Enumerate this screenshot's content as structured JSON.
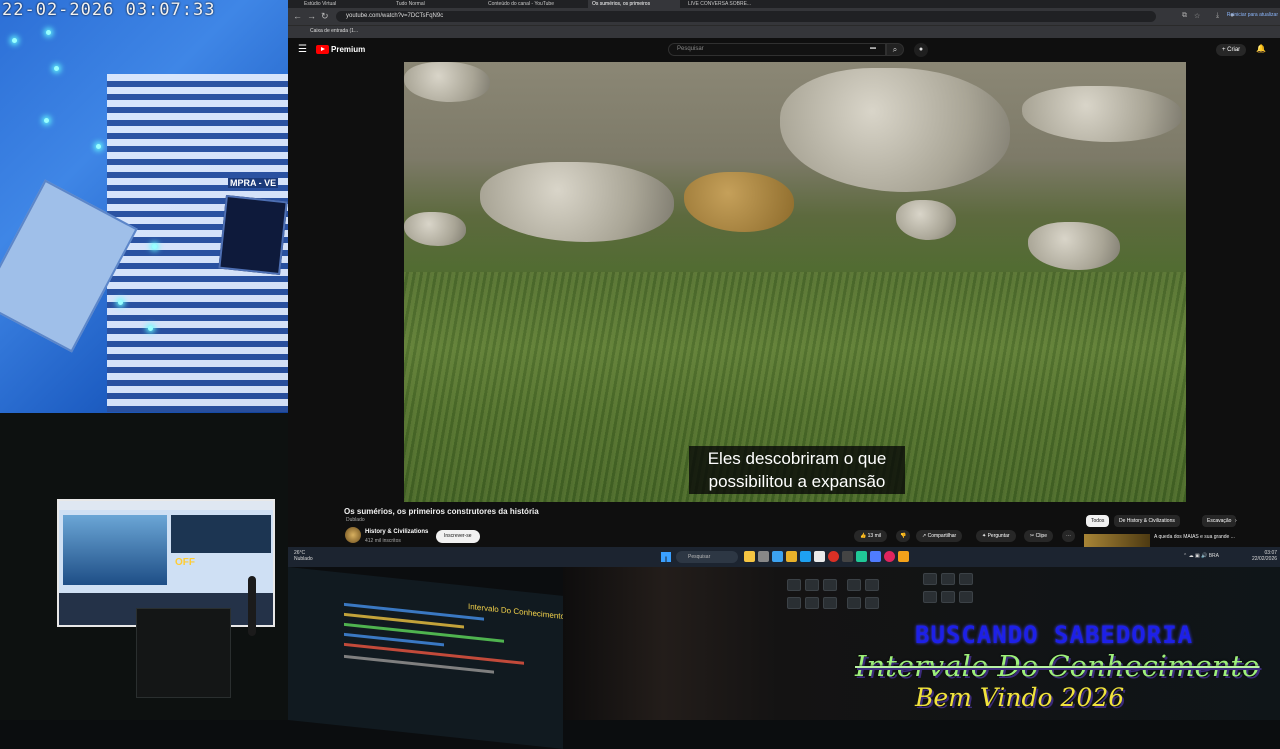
{
  "camera": {
    "timestamp": "22-02-2026 03:07:33",
    "sign_text": "MPRA - VE"
  },
  "browser": {
    "tabs": [
      "Estúdio Virtual",
      "Tudo Normal",
      "Conteúdo do canal - YouTube",
      "Os sumérios, os primeiros",
      "LIVE CONVERSA SOBRE..."
    ],
    "url": "youtube.com/watch?v=7DCTsFqN9c",
    "update_label": "Reiniciar para atualizar",
    "bookmark": "Caixa de entrada (1...",
    "youtube": {
      "logo_text": "Premium",
      "search_placeholder": "Pesquisar",
      "create_label": "Criar"
    },
    "video": {
      "subtitle_line1": "Eles descobriram o que",
      "subtitle_line2": "possibilitou a expansão"
    },
    "info": {
      "title": "Os sumérios, os primeiros construtores da história",
      "meta": "Dublado",
      "channel": "History & Civilizations",
      "subscribers": "412 mil inscritos",
      "subscribe_label": "Inscrever-se",
      "likes": "13 mil",
      "share": "Compartilhar",
      "save": "Perguntar",
      "clip": "Clipe",
      "chips": [
        "Todos",
        "De History & Civilizations",
        "Escavação"
      ],
      "rec_title": "A queda dos MAIAS e sua grande ...",
      "more": "⋯"
    }
  },
  "taskbar": {
    "weather_temp": "26°C",
    "weather_desc": "Nublado",
    "search_placeholder": "Pesquisar",
    "tray": "BRA",
    "time": "03:07",
    "date": "22/02/2026"
  },
  "monitor": {
    "badge": "OFF"
  },
  "daw": {
    "title": "Intervalo Do Conhecimento"
  },
  "overlay": {
    "line1": "BUSCANDO SABEDORIA",
    "line2": "Intervalo Do Conhecimento",
    "line3": "Bem Vindo 2026"
  },
  "colors": {
    "youtube_red": "#ff0000",
    "overlay_blue": "#1d20e8",
    "overlay_green": "#9ef07a",
    "overlay_yellow": "#f1e33c"
  }
}
